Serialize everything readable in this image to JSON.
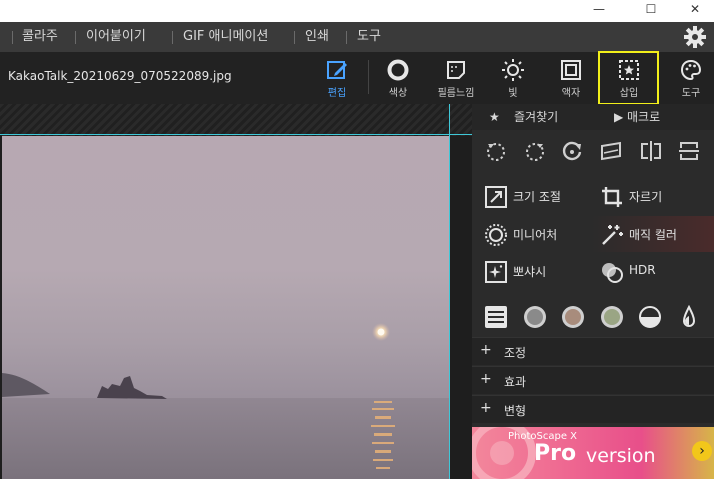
{
  "window": {
    "minimize": "—",
    "maximize": "☐",
    "close": "✕"
  },
  "menu": [
    "콜라주",
    "이어붙이기",
    "GIF 애니메이션",
    "인쇄",
    "도구"
  ],
  "file": {
    "name": "KakaoTalk_20210629_070522089.jpg"
  },
  "toolbar": {
    "edit": "편집",
    "color": "색상",
    "film": "필름느낌",
    "light": "빛",
    "frame": "액자",
    "insert": "삽입",
    "tools": "도구"
  },
  "panel": {
    "favorites": "즐겨찾기",
    "macro": "매크로",
    "resize": "크기 조절",
    "crop": "자르기",
    "miniature": "미니어처",
    "magic_color": "매직 컬러",
    "bloom": "뽀샤시",
    "hdr": "HDR",
    "sections": [
      "조정",
      "효과",
      "변형"
    ]
  },
  "ad": {
    "small": "PhotoScape X",
    "pro": "Pro",
    "version": "version"
  },
  "colors": {
    "accent": "#4aa3ff",
    "highlight": "#f2ef1a",
    "guide": "#3fc8d8"
  }
}
